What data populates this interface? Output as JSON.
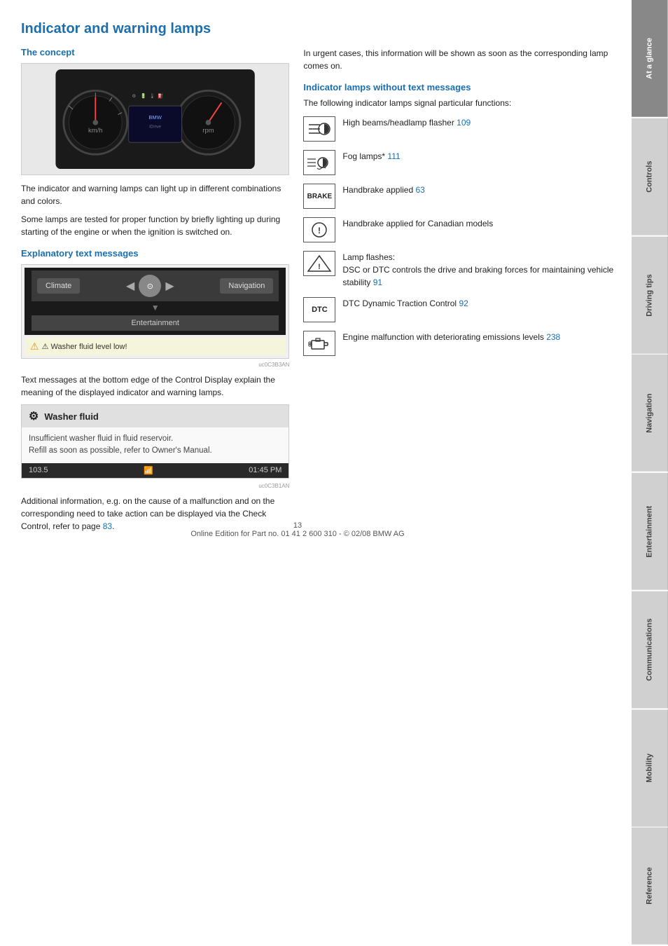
{
  "page": {
    "title": "Indicator and warning lamps",
    "footer": "13\nOnline Edition for Part no. 01 41 2 600 310 - © 02/08 BMW AG"
  },
  "left_col": {
    "concept_title": "The concept",
    "body1": "The indicator and warning lamps can light up in different combinations and colors.",
    "body2": "Some lamps are tested for proper function by briefly lighting up during starting of the engine or when the ignition is switched on.",
    "explanatory_title": "Explanatory text messages",
    "display_labels": {
      "climate": "Climate",
      "navigation": "Navigation",
      "entertainment": "Entertainment",
      "warning": "⚠ Washer fluid level low!"
    },
    "text_messages_body": "Text messages at the bottom edge of the Control Display explain the meaning of the displayed indicator and warning lamps.",
    "washer_header": "Washer fluid",
    "washer_body": "Insufficient washer fluid in fluid reservoir.\nRefill as soon as possible, refer to Owner's Manual.",
    "washer_footer_left": "103.5",
    "washer_footer_right": "01:45 PM",
    "additional_body": "Additional information, e.g. on the cause of a malfunction and on the corresponding need to take action can be displayed via the Check Control, refer to page",
    "additional_link": "83",
    "additional_after": "."
  },
  "right_col": {
    "urgent_text": "In urgent cases, this information will be shown as soon as the corresponding lamp comes on.",
    "section_title": "Indicator lamps without text messages",
    "intro": "The following indicator lamps signal particular functions:",
    "indicators": [
      {
        "icon_type": "highbeam",
        "icon_text": "≡(",
        "label": "High beams/headlamp flasher",
        "page_ref": "109"
      },
      {
        "icon_type": "foglamp",
        "icon_text": "‡D",
        "label": "Fog lamps*",
        "page_ref": "111"
      },
      {
        "icon_type": "brake",
        "icon_text": "BRAKE",
        "label": "Handbrake applied",
        "page_ref": "63"
      },
      {
        "icon_type": "canadian-brake",
        "icon_text": "Ⓘ",
        "label": "Handbrake applied for Canadian models",
        "page_ref": ""
      },
      {
        "icon_type": "lamp-flash",
        "icon_text": "⚠",
        "label": "Lamp flashes:\nDSC or DTC controls the drive and braking forces for maintaining vehicle stability",
        "page_ref": "91"
      },
      {
        "icon_type": "dtc",
        "icon_text": "DTC",
        "label": "DTC Dynamic Traction Control",
        "page_ref": "92"
      },
      {
        "icon_type": "engine",
        "icon_text": "🔧",
        "label": "Engine malfunction with deteriorating emissions levels",
        "page_ref": "238"
      }
    ]
  },
  "sidebar": {
    "tabs": [
      {
        "label": "At a glance",
        "active": true
      },
      {
        "label": "Controls",
        "active": false
      },
      {
        "label": "Driving tips",
        "active": false
      },
      {
        "label": "Navigation",
        "active": false
      },
      {
        "label": "Entertainment",
        "active": false
      },
      {
        "label": "Communications",
        "active": false
      },
      {
        "label": "Mobility",
        "active": false
      },
      {
        "label": "Reference",
        "active": false
      }
    ]
  }
}
